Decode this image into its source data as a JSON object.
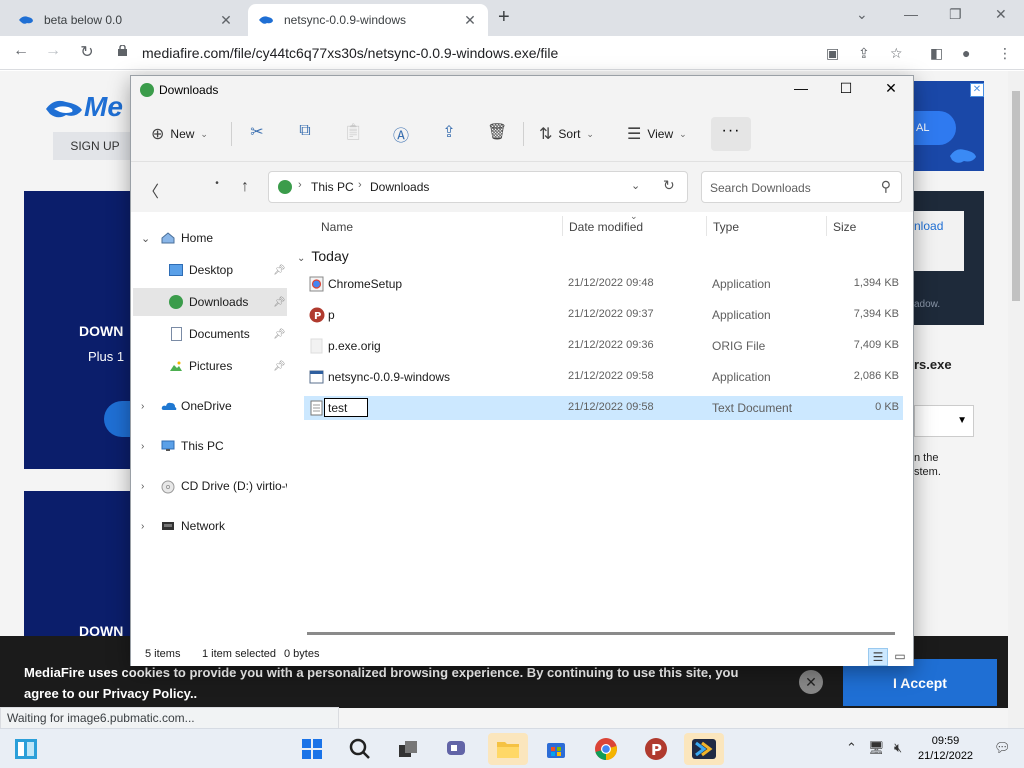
{
  "browser": {
    "tabs": [
      {
        "title": "beta below 0.0",
        "close": "✕"
      },
      {
        "title": "netsync-0.0.9-windows",
        "close": "✕"
      }
    ],
    "new_tab": "+",
    "url": "mediafire.com/file/cy44tc6q77xs30s/netsync-0.0.9-windows.exe/file"
  },
  "page": {
    "logo": "Me",
    "signup": "SIGN UP",
    "blue1_heading": "DOWN",
    "blue1_sub": "Plus 1",
    "blue2_heading": "DOWN",
    "ad_pill": "AL",
    "download_btn": "nload",
    "download_note": "adow.",
    "side_filename": "rs.exe",
    "side_text1": "n the",
    "side_text2": "stem.",
    "cookie_msg": "MediaFire uses cookies to provide you with a personalized browsing experience. By continuing to use this site, you agree to our Privacy Policy..",
    "cookie_close": "✕",
    "cookie_accept": "I Accept",
    "status": "Waiting for image6.pubmatic.com..."
  },
  "explorer": {
    "title": "Downloads",
    "commands": {
      "new": "New",
      "sort": "Sort",
      "view": "View",
      "more": "···"
    },
    "address": {
      "crumbs": [
        "This PC",
        "Downloads"
      ],
      "search_placeholder": "Search Downloads"
    },
    "nav": [
      {
        "label": "Home"
      },
      {
        "label": "Desktop"
      },
      {
        "label": "Downloads"
      },
      {
        "label": "Documents"
      },
      {
        "label": "Pictures"
      },
      {
        "label": "OneDrive"
      },
      {
        "label": "This PC"
      },
      {
        "label": "CD Drive (D:) virtio-win"
      },
      {
        "label": "Network"
      }
    ],
    "columns": {
      "name": "Name",
      "date": "Date modified",
      "type": "Type",
      "size": "Size"
    },
    "group": "Today",
    "files": [
      {
        "name": "ChromeSetup",
        "date": "21/12/2022 09:48",
        "type": "Application",
        "size": "1,394 KB"
      },
      {
        "name": "p",
        "date": "21/12/2022 09:37",
        "type": "Application",
        "size": "7,394 KB"
      },
      {
        "name": "p.exe.orig",
        "date": "21/12/2022 09:36",
        "type": "ORIG File",
        "size": "7,409 KB"
      },
      {
        "name": "netsync-0.0.9-windows",
        "date": "21/12/2022 09:58",
        "type": "Application",
        "size": "2,086 KB"
      },
      {
        "name": "test",
        "date": "21/12/2022 09:58",
        "type": "Text Document",
        "size": "0 KB"
      }
    ],
    "status": {
      "items": "5 items",
      "selected": "1 item selected",
      "bytes": "0 bytes"
    }
  },
  "taskbar": {
    "time": "09:59",
    "date": "21/12/2022"
  },
  "colors": {
    "accent": "#1f6fd4",
    "selection": "#cce8ff"
  }
}
